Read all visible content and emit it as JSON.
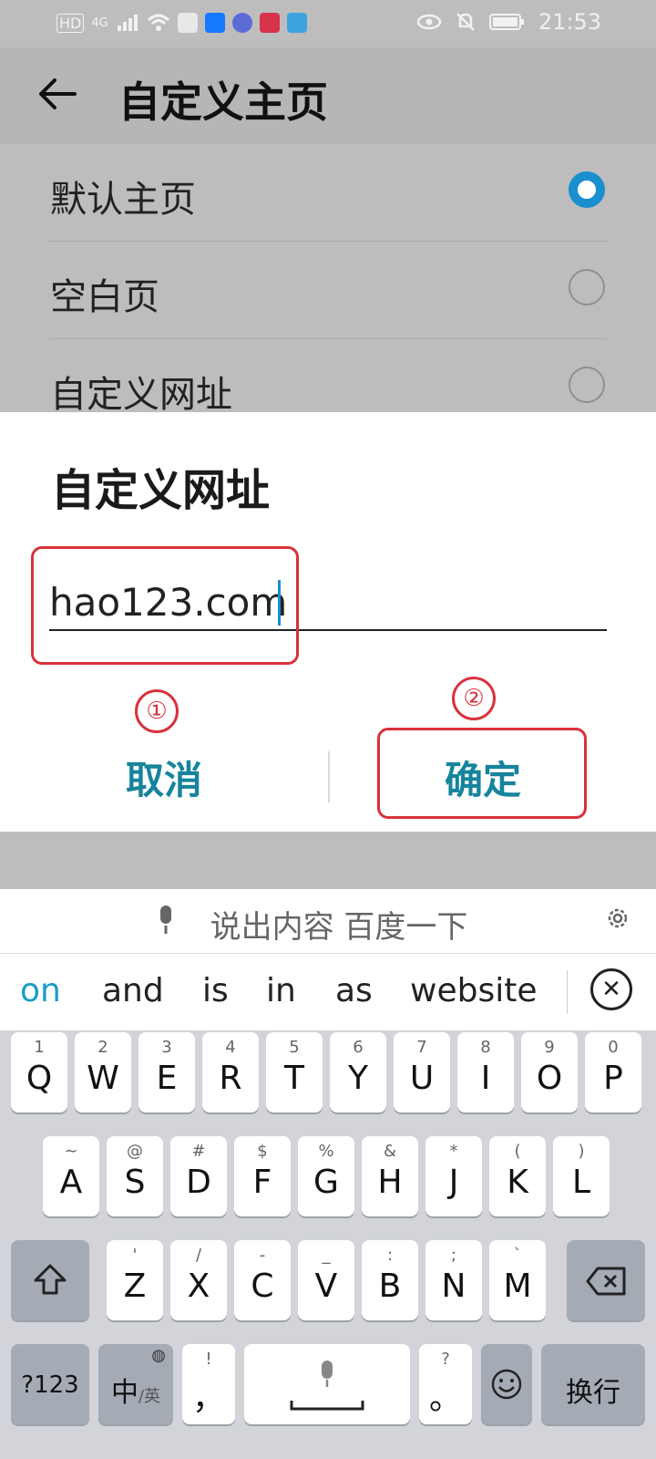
{
  "status_bar": {
    "left_labels": [
      "HD",
      "4G"
    ],
    "time": "21:53"
  },
  "app_bar": {
    "title": "自定义主页"
  },
  "options": [
    {
      "label": "默认主页",
      "selected": true
    },
    {
      "label": "空白页",
      "selected": false
    },
    {
      "label": "自定义网址",
      "selected": false
    }
  ],
  "dialog": {
    "title": "自定义网址",
    "input_value": "hao123.com",
    "cancel_label": "取消",
    "ok_label": "确定",
    "markers": [
      "①",
      "②"
    ],
    "highlight_color": "#d8323c"
  },
  "keyboard": {
    "voice_hint": "说出内容 百度一下",
    "suggestions": [
      "on",
      "and",
      "is",
      "in",
      "as",
      "website"
    ],
    "row1": [
      {
        "main": "Q",
        "sub": "1"
      },
      {
        "main": "W",
        "sub": "2"
      },
      {
        "main": "E",
        "sub": "3"
      },
      {
        "main": "R",
        "sub": "4"
      },
      {
        "main": "T",
        "sub": "5"
      },
      {
        "main": "Y",
        "sub": "6"
      },
      {
        "main": "U",
        "sub": "7"
      },
      {
        "main": "I",
        "sub": "8"
      },
      {
        "main": "O",
        "sub": "9"
      },
      {
        "main": "P",
        "sub": "0"
      }
    ],
    "row2": [
      {
        "main": "A",
        "sub": "~"
      },
      {
        "main": "S",
        "sub": "@"
      },
      {
        "main": "D",
        "sub": "#"
      },
      {
        "main": "F",
        "sub": "$"
      },
      {
        "main": "G",
        "sub": "%"
      },
      {
        "main": "H",
        "sub": "&"
      },
      {
        "main": "J",
        "sub": "*"
      },
      {
        "main": "K",
        "sub": "("
      },
      {
        "main": "L",
        "sub": ")"
      }
    ],
    "row3": [
      {
        "main": "Z",
        "sub": "'"
      },
      {
        "main": "X",
        "sub": "/"
      },
      {
        "main": "C",
        "sub": "-"
      },
      {
        "main": "V",
        "sub": "_"
      },
      {
        "main": "B",
        "sub": ":"
      },
      {
        "main": "N",
        "sub": ";"
      },
      {
        "main": "M",
        "sub": "`"
      }
    ],
    "num_key": "?123",
    "lang_key_main": "中",
    "lang_key_sub": "/英",
    "comma_key": {
      "main": "，",
      "sub": "!"
    },
    "period_key": {
      "main": "。",
      "sub": "?"
    },
    "enter_key": "换行"
  },
  "colors": {
    "accent_blue": "#1a8fd0",
    "button_teal": "#16849c"
  }
}
